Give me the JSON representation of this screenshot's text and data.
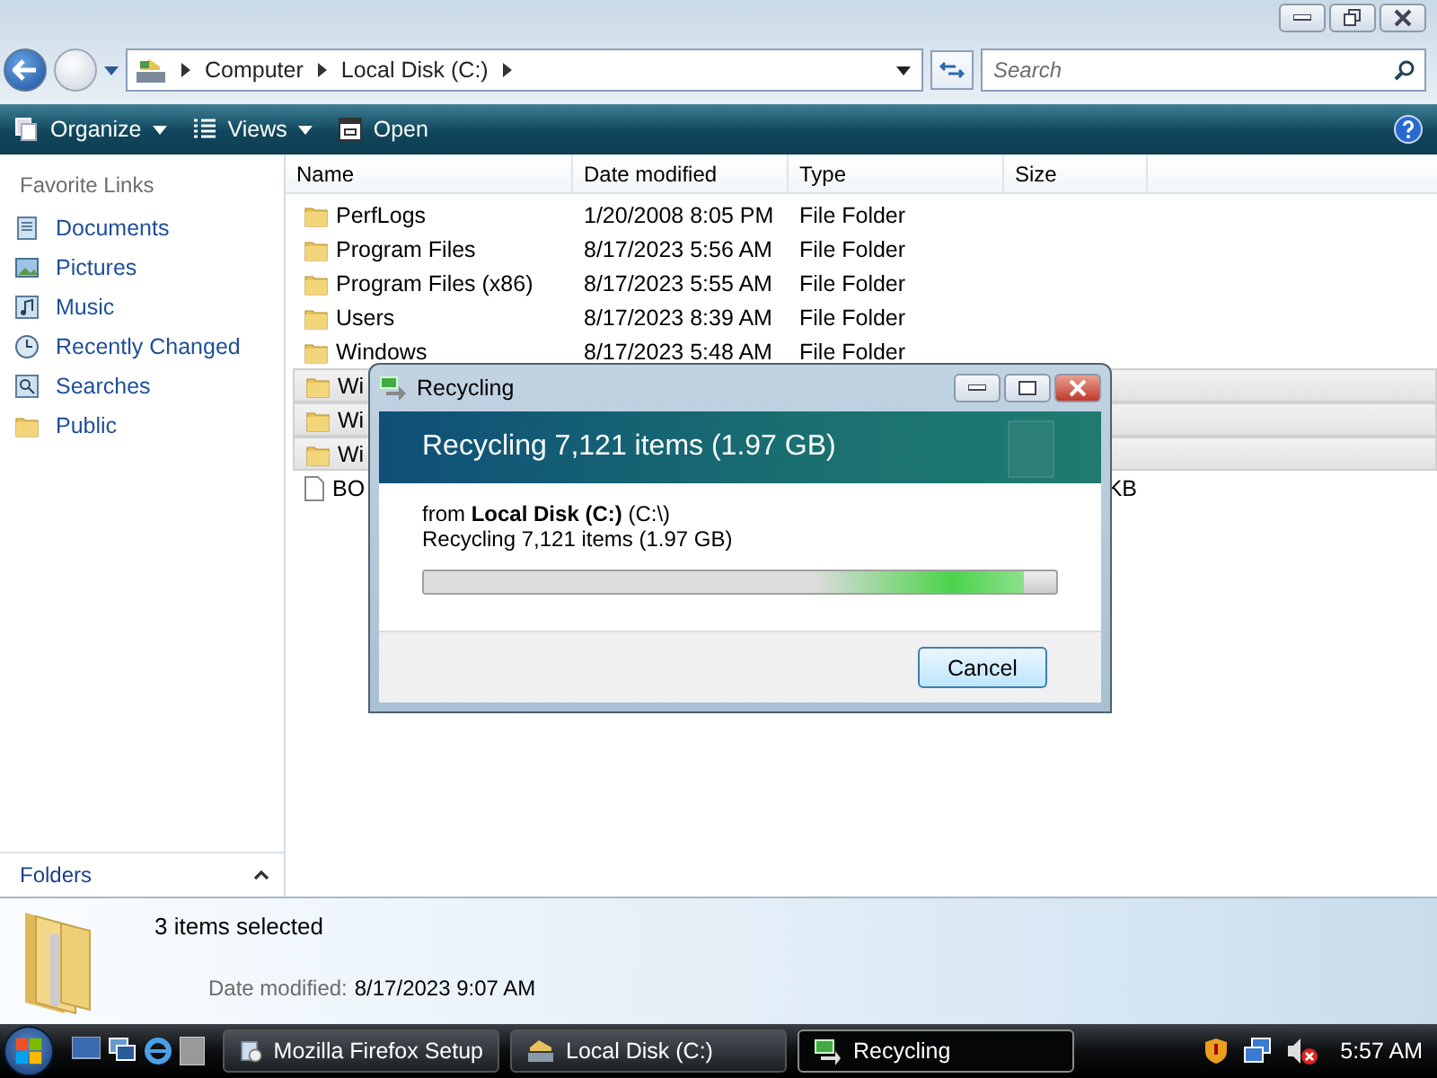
{
  "address": {
    "crumbs": [
      "Computer",
      "Local Disk (C:)"
    ]
  },
  "search": {
    "placeholder": "Search"
  },
  "toolbar": [
    {
      "label": "Organize",
      "dropdown": true,
      "kind": "organize"
    },
    {
      "label": "Views",
      "dropdown": true,
      "kind": "views"
    },
    {
      "label": "Open",
      "dropdown": false,
      "kind": "open"
    }
  ],
  "sidebar": {
    "heading": "Favorite Links",
    "items": [
      {
        "label": "Documents",
        "kind": "documents"
      },
      {
        "label": "Pictures",
        "kind": "pictures"
      },
      {
        "label": "Music",
        "kind": "music"
      },
      {
        "label": "Recently Changed",
        "kind": "recent"
      },
      {
        "label": "Searches",
        "kind": "searches"
      },
      {
        "label": "Public",
        "kind": "folder"
      }
    ],
    "folders": "Folders"
  },
  "table": {
    "columns": [
      "Name",
      "Date modified",
      "Type",
      "Size"
    ],
    "rows": [
      {
        "name": "PerfLogs",
        "date": "1/20/2008 8:05 PM",
        "type": "File Folder",
        "kind": "folder",
        "selected": false
      },
      {
        "name": "Program Files",
        "date": "8/17/2023 5:56 AM",
        "type": "File Folder",
        "kind": "folder",
        "selected": false
      },
      {
        "name": "Program Files (x86)",
        "date": "8/17/2023 5:55 AM",
        "type": "File Folder",
        "kind": "folder",
        "selected": false
      },
      {
        "name": "Users",
        "date": "8/17/2023 8:39 AM",
        "type": "File Folder",
        "kind": "folder",
        "selected": false
      },
      {
        "name": "Windows",
        "date": "8/17/2023 5:48 AM",
        "type": "File Folder",
        "kind": "folder",
        "selected": false
      },
      {
        "name": "Wi",
        "kind": "folder",
        "selected": true
      },
      {
        "name": "Wi",
        "kind": "folder",
        "selected": true
      },
      {
        "name": "Wi",
        "kind": "folder",
        "selected": true
      },
      {
        "name": "BO",
        "size": "KB",
        "kind": "file",
        "selected": false
      }
    ]
  },
  "details": {
    "summary": "3 items selected",
    "label": "Date modified:",
    "value": "8/17/2023 9:07 AM"
  },
  "dialog": {
    "title": "Recycling",
    "header": "Recycling 7,121 items (1.97 GB)",
    "source": "from **Local Disk (C:)** (C:\\)",
    "status": "Recycling 7,121 items (1.97 GB)",
    "cancel": "Cancel",
    "level": 0.95
  },
  "taskbar": {
    "tasks": [
      {
        "label": "Mozilla Firefox Setup",
        "kind": "installer",
        "selected": false
      },
      {
        "label": "Local Disk (C:)",
        "kind": "folder",
        "selected": false
      },
      {
        "label": "Recycling",
        "kind": "recycle",
        "selected": true
      }
    ],
    "clock": "5:57 AM"
  }
}
